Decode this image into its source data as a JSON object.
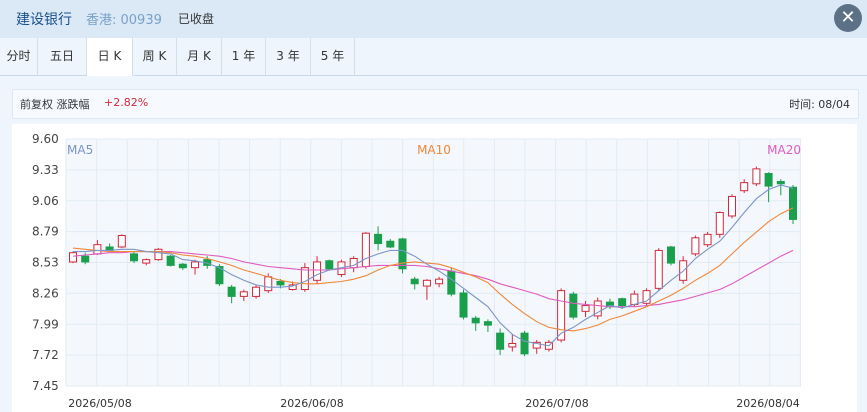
{
  "header": {
    "stock_name": "建设银行",
    "market_code": "香港: 00939",
    "status": "已收盘",
    "close_label": "✕"
  },
  "tabs": [
    {
      "label": "分时"
    },
    {
      "label": "五日"
    },
    {
      "label": "日 K",
      "active": true
    },
    {
      "label": "周 K"
    },
    {
      "label": "月 K"
    },
    {
      "label": "1 年"
    },
    {
      "label": "3 年"
    },
    {
      "label": "5 年"
    }
  ],
  "info": {
    "adjust_label": "前复权 涨跌幅",
    "change": "+2.82%",
    "time_label": "时间: 08/04"
  },
  "colors": {
    "up": "#d0293a",
    "down": "#1aa04c",
    "ma5": "#7b96c8",
    "ma10": "#f0873a",
    "ma20": "#e05bc0"
  },
  "chart_data": {
    "type": "candlestick",
    "y_ticks": [
      "9.60",
      "9.33",
      "9.06",
      "8.79",
      "8.53",
      "8.26",
      "7.99",
      "7.72",
      "7.45"
    ],
    "ylim": [
      7.45,
      9.6
    ],
    "x_ticks": [
      "2026/05/08",
      "2026/06/08",
      "2026/07/08",
      "2026/08/04"
    ],
    "legend": [
      "MA5",
      "MA10",
      "MA20"
    ],
    "candles": [
      [
        8.53,
        8.61,
        8.52,
        8.62
      ],
      [
        8.58,
        8.53,
        8.51,
        8.61
      ],
      [
        8.6,
        8.68,
        8.59,
        8.72
      ],
      [
        8.66,
        8.63,
        8.62,
        8.69
      ],
      [
        8.66,
        8.76,
        8.65,
        8.77
      ],
      [
        8.6,
        8.54,
        8.52,
        8.62
      ],
      [
        8.52,
        8.55,
        8.5,
        8.56
      ],
      [
        8.55,
        8.64,
        8.54,
        8.65
      ],
      [
        8.58,
        8.5,
        8.49,
        8.59
      ],
      [
        8.51,
        8.48,
        8.46,
        8.52
      ],
      [
        8.48,
        8.53,
        8.42,
        8.55
      ],
      [
        8.55,
        8.5,
        8.47,
        8.58
      ],
      [
        8.49,
        8.34,
        8.32,
        8.51
      ],
      [
        8.31,
        8.23,
        8.17,
        8.33
      ],
      [
        8.23,
        8.27,
        8.19,
        8.29
      ],
      [
        8.23,
        8.31,
        8.21,
        8.33
      ],
      [
        8.28,
        8.4,
        8.26,
        8.43
      ],
      [
        8.36,
        8.33,
        8.3,
        8.38
      ],
      [
        8.29,
        8.33,
        8.28,
        8.36
      ],
      [
        8.29,
        8.48,
        8.27,
        8.52
      ],
      [
        8.37,
        8.53,
        8.34,
        8.58
      ],
      [
        8.54,
        8.47,
        8.46,
        8.55
      ],
      [
        8.42,
        8.53,
        8.4,
        8.55
      ],
      [
        8.48,
        8.56,
        8.44,
        8.58
      ],
      [
        8.49,
        8.78,
        8.47,
        8.79
      ],
      [
        8.77,
        8.69,
        8.63,
        8.84
      ],
      [
        8.71,
        8.66,
        8.65,
        8.73
      ],
      [
        8.73,
        8.47,
        8.43,
        8.74
      ],
      [
        8.38,
        8.34,
        8.29,
        8.4
      ],
      [
        8.32,
        8.37,
        8.2,
        8.38
      ],
      [
        8.34,
        8.38,
        8.31,
        8.4
      ],
      [
        8.45,
        8.25,
        8.23,
        8.48
      ],
      [
        8.26,
        8.05,
        8.03,
        8.29
      ],
      [
        8.04,
        8.0,
        7.93,
        8.06
      ],
      [
        8.01,
        7.98,
        7.92,
        8.03
      ],
      [
        7.91,
        7.77,
        7.72,
        7.95
      ],
      [
        7.79,
        7.82,
        7.75,
        7.9
      ],
      [
        7.91,
        7.73,
        7.71,
        7.93
      ],
      [
        7.78,
        7.83,
        7.73,
        7.85
      ],
      [
        7.77,
        7.83,
        7.75,
        7.85
      ],
      [
        7.85,
        8.28,
        7.83,
        8.3
      ],
      [
        8.25,
        8.05,
        8.03,
        8.27
      ],
      [
        8.1,
        8.15,
        8.05,
        8.19
      ],
      [
        8.06,
        8.19,
        8.03,
        8.22
      ],
      [
        8.18,
        8.14,
        8.12,
        8.21
      ],
      [
        8.21,
        8.15,
        8.12,
        8.22
      ],
      [
        8.16,
        8.25,
        8.14,
        8.28
      ],
      [
        8.17,
        8.28,
        8.15,
        8.3
      ],
      [
        8.3,
        8.63,
        8.28,
        8.65
      ],
      [
        8.66,
        8.52,
        8.5,
        8.67
      ],
      [
        8.37,
        8.54,
        8.34,
        8.58
      ],
      [
        8.6,
        8.74,
        8.58,
        8.76
      ],
      [
        8.68,
        8.77,
        8.66,
        8.79
      ],
      [
        8.77,
        8.96,
        8.74,
        8.97
      ],
      [
        8.93,
        9.1,
        8.91,
        9.12
      ],
      [
        9.15,
        9.22,
        9.13,
        9.25
      ],
      [
        9.21,
        9.34,
        9.19,
        9.36
      ],
      [
        9.3,
        9.19,
        9.05,
        9.31
      ],
      [
        9.23,
        9.21,
        9.11,
        9.25
      ],
      [
        9.18,
        8.9,
        8.86,
        9.2
      ]
    ],
    "ma5": [
      8.62,
      8.62,
      8.63,
      8.63,
      8.64,
      8.64,
      8.62,
      8.61,
      8.6,
      8.55,
      8.54,
      8.52,
      8.48,
      8.42,
      8.37,
      8.33,
      8.31,
      8.31,
      8.32,
      8.36,
      8.42,
      8.46,
      8.48,
      8.5,
      8.56,
      8.6,
      8.63,
      8.63,
      8.58,
      8.51,
      8.45,
      8.38,
      8.3,
      8.22,
      8.14,
      8.0,
      7.9,
      7.84,
      7.82,
      7.8,
      7.91,
      7.96,
      8.03,
      8.09,
      8.15,
      8.13,
      8.16,
      8.19,
      8.28,
      8.37,
      8.45,
      8.56,
      8.64,
      8.71,
      8.83,
      8.96,
      9.08,
      9.16,
      9.2,
      9.17
    ],
    "ma10": [
      8.65,
      8.64,
      8.63,
      8.62,
      8.62,
      8.62,
      8.62,
      8.62,
      8.61,
      8.59,
      8.58,
      8.56,
      8.53,
      8.5,
      8.46,
      8.43,
      8.4,
      8.37,
      8.35,
      8.34,
      8.34,
      8.35,
      8.36,
      8.38,
      8.41,
      8.46,
      8.5,
      8.52,
      8.53,
      8.52,
      8.51,
      8.48,
      8.44,
      8.4,
      8.35,
      8.25,
      8.16,
      8.08,
      8.01,
      7.96,
      7.94,
      7.93,
      7.95,
      7.98,
      8.03,
      8.06,
      8.1,
      8.14,
      8.19,
      8.24,
      8.3,
      8.37,
      8.43,
      8.5,
      8.6,
      8.7,
      8.79,
      8.88,
      8.95,
      9.0
    ],
    "ma20": [
      8.58,
      8.59,
      8.6,
      8.61,
      8.61,
      8.62,
      8.62,
      8.62,
      8.62,
      8.61,
      8.6,
      8.59,
      8.58,
      8.56,
      8.53,
      8.51,
      8.49,
      8.48,
      8.47,
      8.46,
      8.46,
      8.46,
      8.47,
      8.48,
      8.49,
      8.5,
      8.5,
      8.5,
      8.5,
      8.49,
      8.47,
      8.45,
      8.43,
      8.41,
      8.38,
      8.34,
      8.31,
      8.28,
      8.25,
      8.21,
      8.19,
      8.17,
      8.16,
      8.15,
      8.14,
      8.14,
      8.14,
      8.15,
      8.16,
      8.18,
      8.2,
      8.23,
      8.26,
      8.29,
      8.34,
      8.4,
      8.46,
      8.52,
      8.58,
      8.63
    ]
  }
}
